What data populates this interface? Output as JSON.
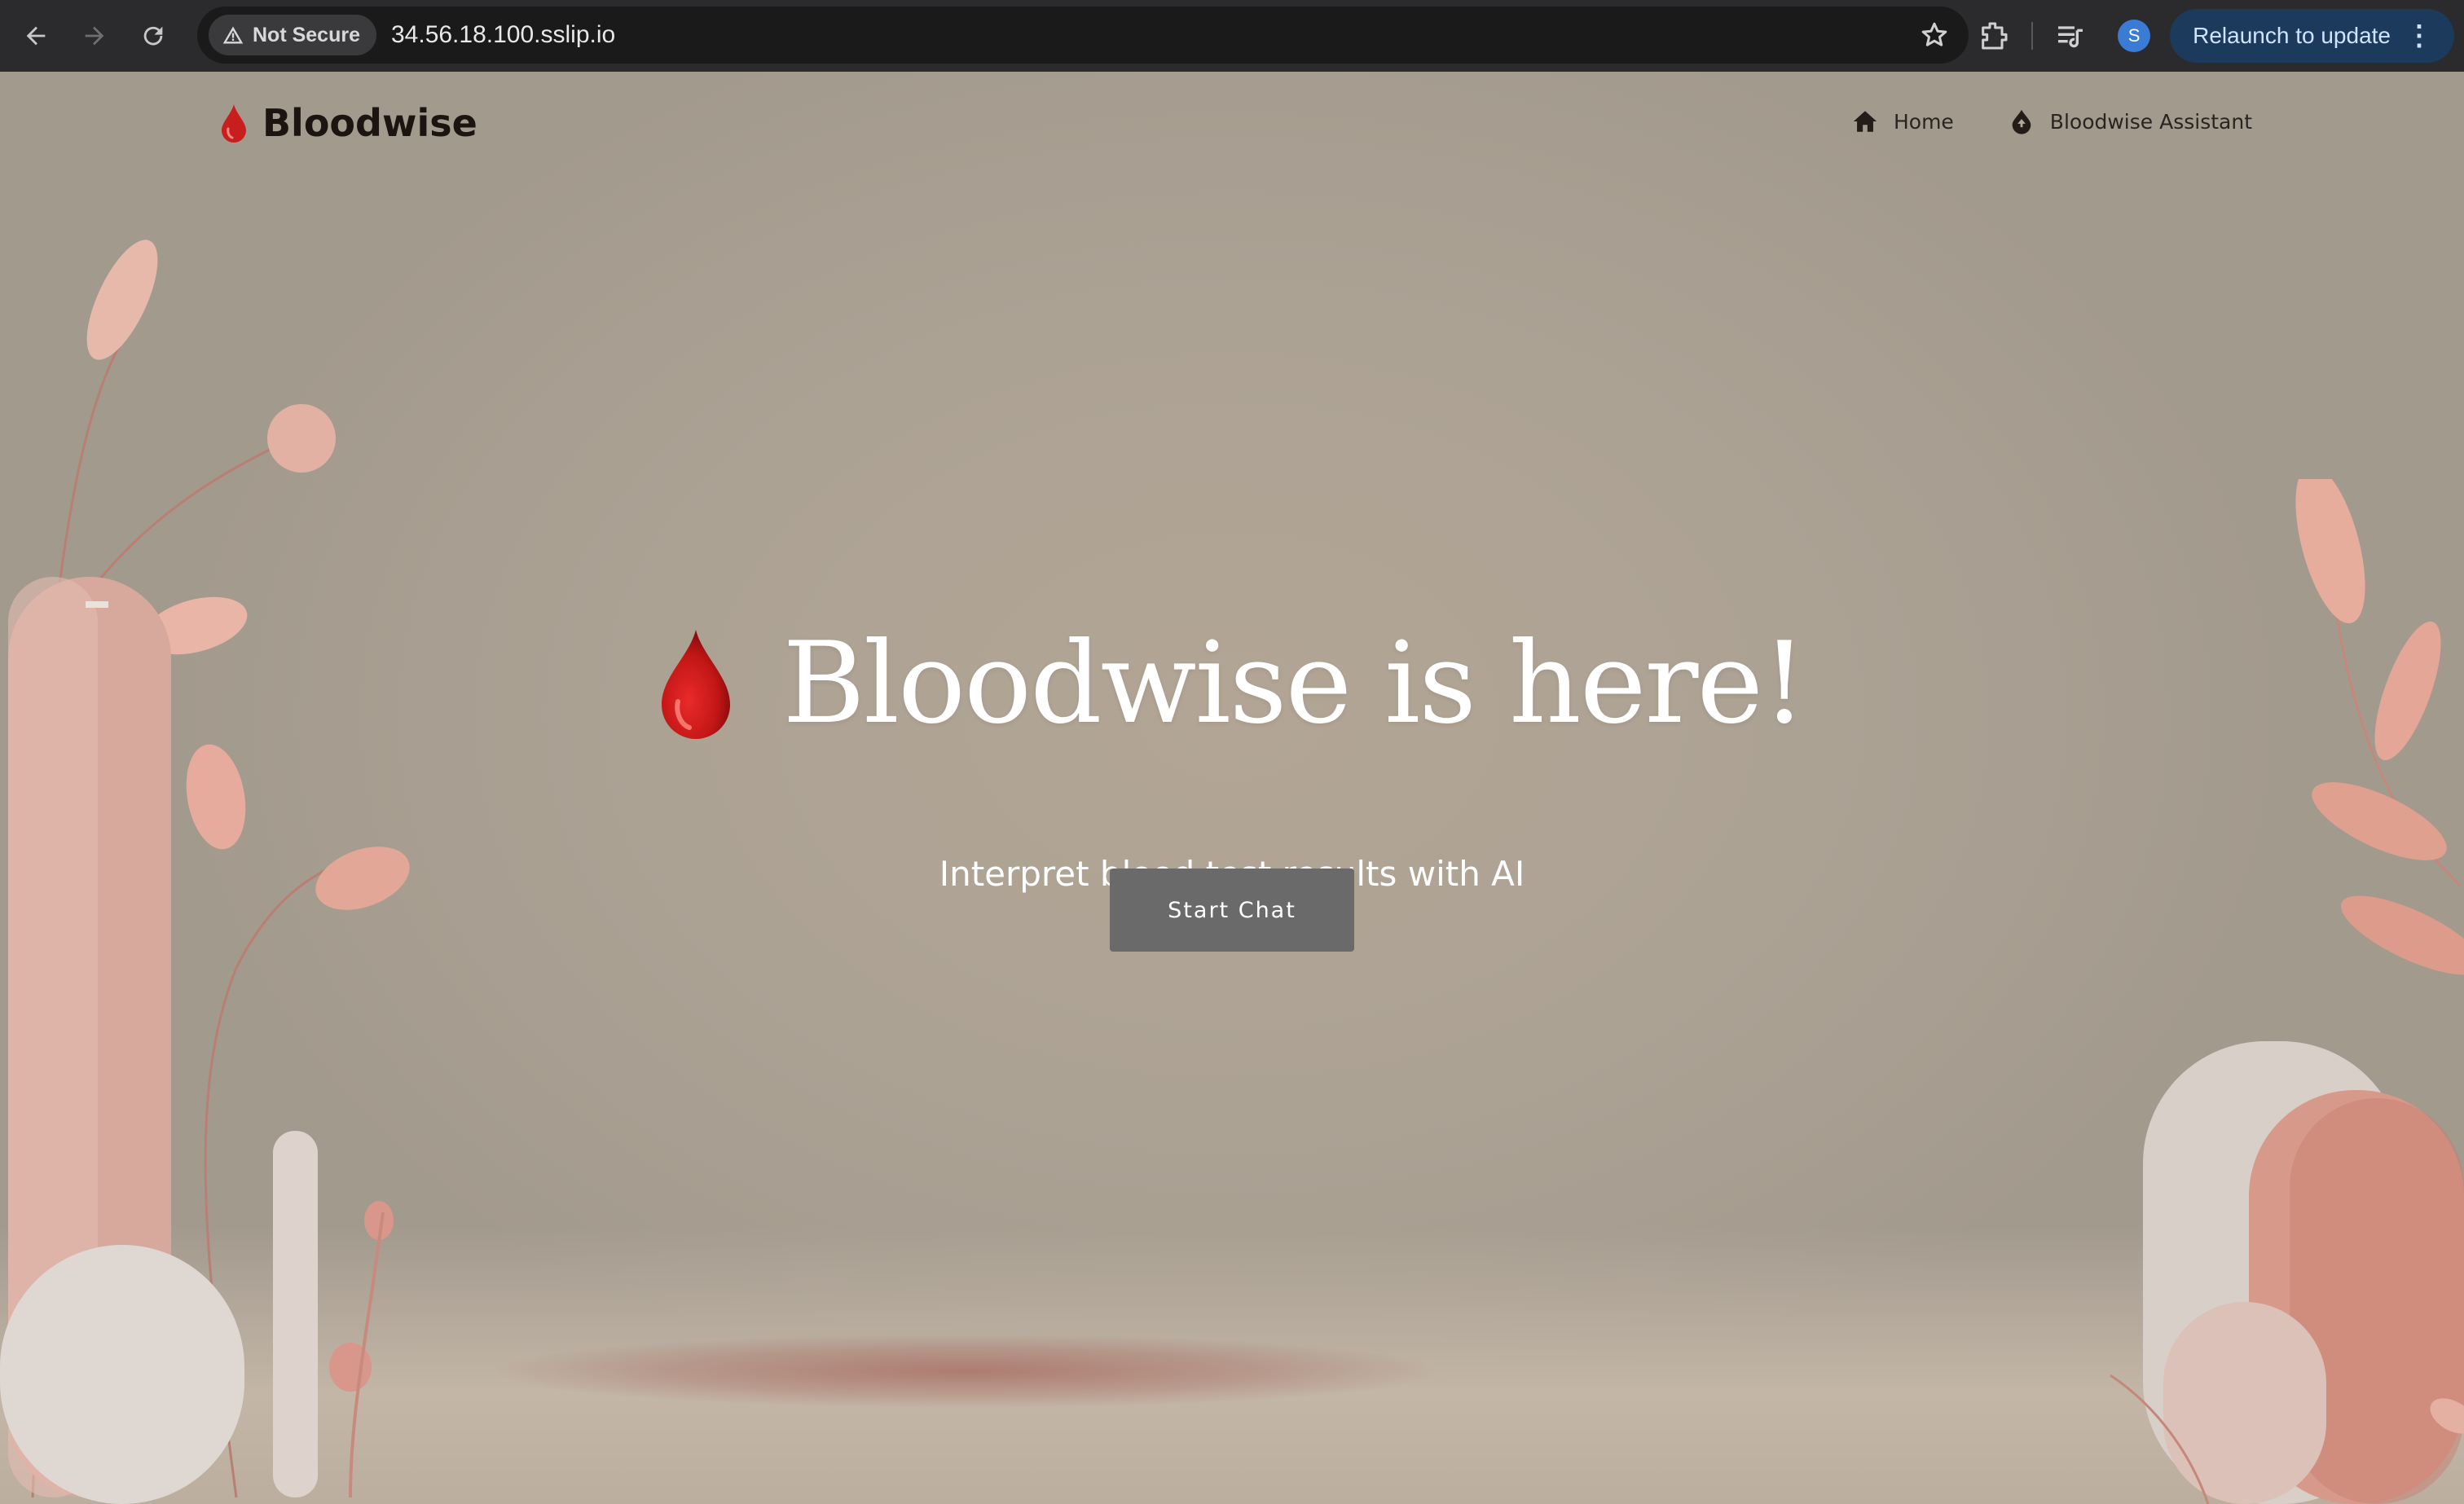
{
  "browser": {
    "security_label": "Not Secure",
    "url": "34.56.18.100.sslip.io",
    "profile_initial": "S",
    "relaunch_label": "Relaunch to update",
    "menu_glyph": "⋮"
  },
  "site": {
    "brand_name": "Bloodwise",
    "nav": {
      "home_label": "Home",
      "assistant_label": "Bloodwise Assistant"
    }
  },
  "hero": {
    "title": "Bloodwise is here!",
    "subtitle": "Interpret blood test results with AI",
    "cta_label": "Start Chat"
  },
  "colors": {
    "blood_red": "#c81e1e",
    "button_gray": "#6b6a6a",
    "background": "#aca294",
    "accent_pink": "#d99a8c"
  },
  "icons": [
    "back-arrow-icon",
    "forward-arrow-icon",
    "reload-icon",
    "warning-icon",
    "star-icon",
    "extensions-icon",
    "media-queue-icon",
    "blood-drop-icon",
    "home-icon",
    "blood-drop-up-icon"
  ]
}
